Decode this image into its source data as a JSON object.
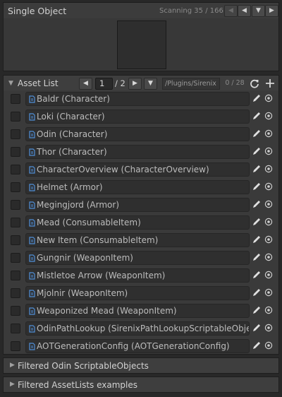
{
  "header": {
    "title": "Single Object",
    "scan_status": "Scanning 35 / 166"
  },
  "list": {
    "title": "Asset List",
    "page": "1",
    "page_total": "/ 2",
    "path": "/Plugins/Sirenix",
    "count": "0 / 28",
    "items": [
      {
        "label": "Baldr (Character)"
      },
      {
        "label": "Loki (Character)"
      },
      {
        "label": "Odin (Character)"
      },
      {
        "label": "Thor (Character)"
      },
      {
        "label": "CharacterOverview (CharacterOverview)"
      },
      {
        "label": "Helmet (Armor)"
      },
      {
        "label": "Megingjord (Armor)"
      },
      {
        "label": "Mead (ConsumableItem)"
      },
      {
        "label": "New Item (ConsumableItem)"
      },
      {
        "label": "Gungnir (WeaponItem)"
      },
      {
        "label": "Mistletoe Arrow (WeaponItem)"
      },
      {
        "label": "Mjolnir (WeaponItem)"
      },
      {
        "label": "Weaponized Mead (WeaponItem)"
      },
      {
        "label": "OdinPathLookup (SirenixPathLookupScriptableObject)"
      },
      {
        "label": "AOTGenerationConfig (AOTGenerationConfig)"
      }
    ]
  },
  "foldouts": [
    {
      "label": "Filtered Odin ScriptableObjects"
    },
    {
      "label": "Filtered AssetLists examples"
    }
  ],
  "icons": {
    "fold": "triangle-icon",
    "nav_prev": "arrow-left-icon",
    "nav_next": "arrow-right-icon",
    "dropdown": "arrow-down-icon",
    "refresh": "refresh-icon",
    "add": "plus-icon",
    "edit": "pencil-icon",
    "select": "target-icon",
    "asset": "scriptable-object-icon"
  },
  "colors": {
    "background": "#282828",
    "panel": "#3a3a3a",
    "field": "#2f2f2f",
    "text": "#c8c8c8",
    "icon_blue": "#4f8fd8"
  }
}
